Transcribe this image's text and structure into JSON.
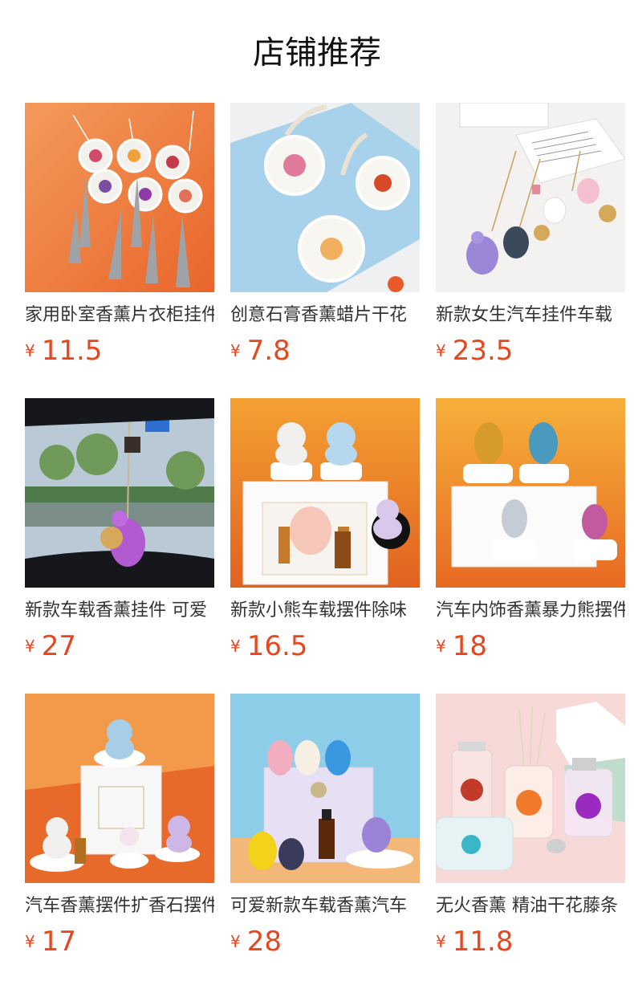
{
  "header": {
    "title": "店铺推荐"
  },
  "currency": "¥",
  "products": [
    {
      "name": "家用卧室香薰片衣柜挂件",
      "price": "11.5",
      "image": "hanging-sachet-icon"
    },
    {
      "name": "创意石膏香薰蜡片干花",
      "price": "7.8",
      "image": "plaster-wax-tablet-icon"
    },
    {
      "name": "新款女生汽车挂件车载",
      "price": "23.5",
      "image": "bear-charm-pendant-icon"
    },
    {
      "name": "新款车载香薰挂件 可爱",
      "price": "27",
      "image": "car-mirror-bear-icon"
    },
    {
      "name": "新款小熊车载摆件除味",
      "price": "16.5",
      "image": "angel-bear-set-icon"
    },
    {
      "name": "汽车内饰香薰暴力熊摆件",
      "price": "18",
      "image": "rabbit-figurine-set-icon"
    },
    {
      "name": "汽车香薰摆件扩香石摆件",
      "price": "17",
      "image": "angel-bear-ornament-icon"
    },
    {
      "name": "可爱新款车载香薰汽车",
      "price": "28",
      "image": "crystal-bear-gift-icon"
    },
    {
      "name": "无火香薰 精油干花藤条",
      "price": "11.8",
      "image": "reed-diffuser-bottle-icon"
    }
  ]
}
